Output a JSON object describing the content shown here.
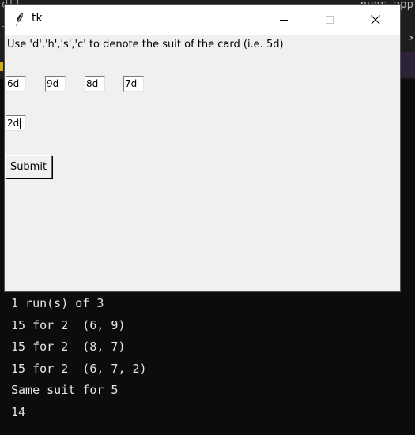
{
  "background": {
    "left_top": "dtt",
    "left_mid": "i",
    "right_top": "nuns app",
    "colors": {
      "editor": "#1e1e1e",
      "terminal": "#0c0c0c"
    }
  },
  "window": {
    "title": "tk",
    "icon": "feather-icon",
    "controls": [
      "minimize-icon",
      "maximize-icon",
      "close-icon"
    ]
  },
  "form": {
    "instruction": "Use 'd','h','s','c' to denote the suit of the card (i.e. 5d)",
    "cards": [
      "6d",
      "9d",
      "8d",
      "7d"
    ],
    "cut_card": "2d",
    "submit_label": "Submit"
  },
  "terminal": {
    "lines": [
      "1 run(s) of 3",
      "15 for 2  (6, 9)",
      "15 for 2  (8, 7)",
      "15 for 2  (6, 7, 2)",
      "Same suit for 5",
      "14"
    ]
  }
}
